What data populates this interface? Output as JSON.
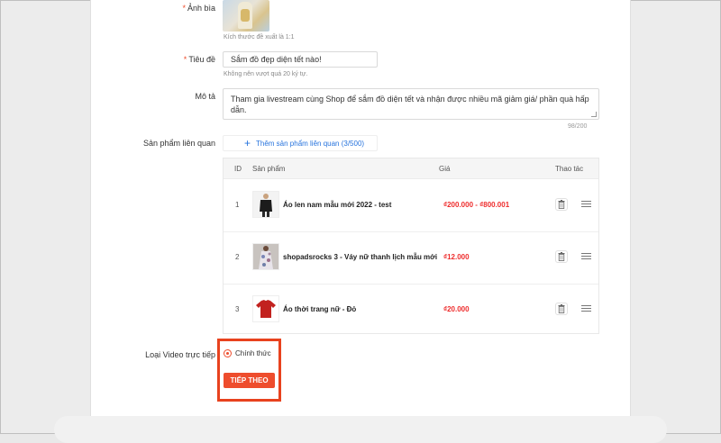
{
  "form": {
    "cover": {
      "label": "Ảnh bìa",
      "hint": "Kích thước đề xuất là 1:1"
    },
    "title": {
      "label": "Tiêu đề",
      "value": "Sắm đồ đẹp diện tết nào!",
      "hint": "Không nên vượt quá 20 ký tự."
    },
    "description": {
      "label": "Mô tả",
      "value": "Tham gia livestream cùng Shop để sắm đồ diện tết và nhận được nhiều mã giảm giá/ phần quà hấp dẫn.",
      "counter": "98/200"
    },
    "related_products": {
      "label": "Sản phẩm liên quan",
      "add_button": "Thêm sản phẩm liên quan (3/500)",
      "columns": {
        "id": "ID",
        "product": "Sản phẩm",
        "price": "Giá",
        "actions": "Thao tác"
      },
      "rows": [
        {
          "id": "1",
          "name": "Áo len nam mẫu mới 2022 - test",
          "price": "₫200.000 - ₫800.001",
          "thumb_icon": "black-sweater-image"
        },
        {
          "id": "2",
          "name": "shopadsrocks 3 - Váy nữ thanh lịch mẫu mới",
          "price": "₫12.000",
          "thumb_icon": "floral-dress-image"
        },
        {
          "id": "3",
          "name": "Áo thời trang nữ - Đỏ",
          "price": "₫20.000",
          "thumb_icon": "red-shirt-image"
        }
      ]
    },
    "video_type": {
      "label": "Loại Video trực tiếp",
      "option": "Chính thức"
    },
    "next_button": "TIẾP THEO"
  },
  "colors": {
    "accent": "#ee4d2d",
    "link": "#2673dd",
    "price": "#ee2d2d"
  }
}
